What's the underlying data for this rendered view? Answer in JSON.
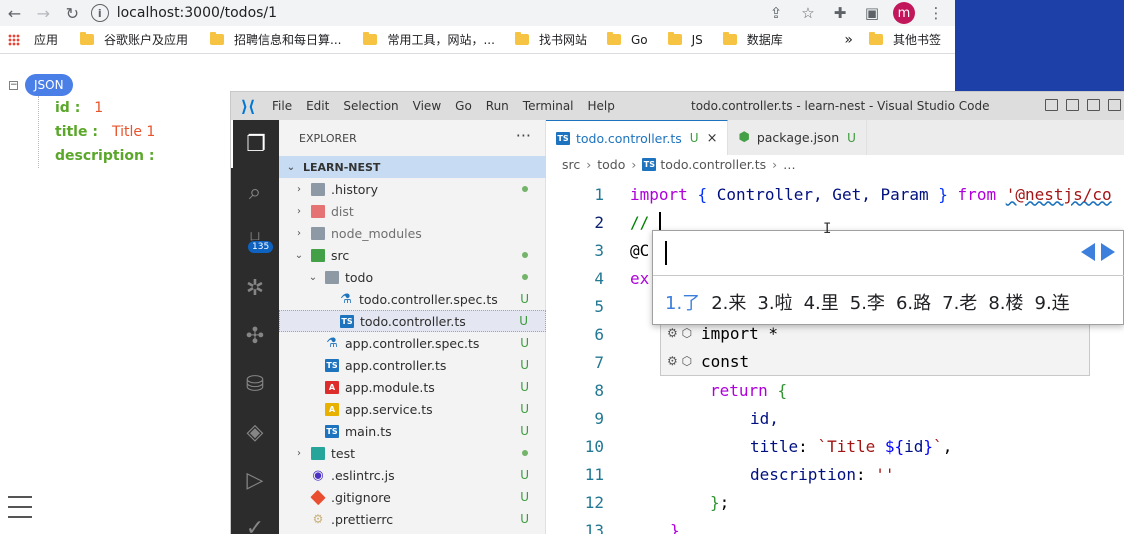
{
  "browser": {
    "url": "localhost:3000/todos/1",
    "bookmarks": [
      {
        "label": "应用",
        "type": "apps"
      },
      {
        "label": "谷歌账户及应用",
        "type": "folder"
      },
      {
        "label": "招聘信息和每日算...",
        "type": "folder"
      },
      {
        "label": "常用工具，网站，...",
        "type": "folder"
      },
      {
        "label": "找书网站",
        "type": "folder"
      },
      {
        "label": "Go",
        "type": "folder"
      },
      {
        "label": "JS",
        "type": "folder"
      },
      {
        "label": "数据库",
        "type": "folder"
      }
    ],
    "bookmarks_overflow": "»",
    "other_bookmarks": "其他书签",
    "avatar_letter": "m"
  },
  "json_viewer": {
    "badge": "JSON",
    "toggle": "−",
    "rows": [
      {
        "key": "id :",
        "value": "1"
      },
      {
        "key": "title :",
        "value": "Title 1"
      },
      {
        "key": "description :",
        "value": ""
      }
    ]
  },
  "vscode": {
    "menu": [
      "File",
      "Edit",
      "Selection",
      "View",
      "Go",
      "Run",
      "Terminal",
      "Help"
    ],
    "window_title": "todo.controller.ts - learn-nest - Visual Studio Code",
    "scm_badge": "135",
    "explorer_title": "EXPLORER",
    "explorer_more": "···",
    "section": "LEARN-NEST",
    "tree": [
      {
        "label": ".history",
        "chev": "›",
        "icon": "folder-g",
        "status": "dot",
        "dim": false
      },
      {
        "label": "dist",
        "chev": "›",
        "icon": "folder-r",
        "status": "",
        "dim": true
      },
      {
        "label": "node_modules",
        "chev": "›",
        "icon": "folder-g",
        "status": "",
        "dim": true
      },
      {
        "label": "src",
        "chev": "⌄",
        "icon": "folder-gr",
        "status": "dot",
        "dim": false
      },
      {
        "label": "todo",
        "chev": "⌄",
        "icon": "folder-g",
        "status": "dot",
        "dim": false
      },
      {
        "label": "todo.controller.spec.ts",
        "chev": "",
        "icon": "spec",
        "status": "U",
        "dim": false
      },
      {
        "label": "todo.controller.ts",
        "chev": "",
        "icon": "ts",
        "status": "U",
        "dim": false,
        "selected": true
      },
      {
        "label": "app.controller.spec.ts",
        "chev": "",
        "icon": "spec",
        "status": "U",
        "dim": false
      },
      {
        "label": "app.controller.ts",
        "chev": "",
        "icon": "ts",
        "status": "U",
        "dim": false
      },
      {
        "label": "app.module.ts",
        "chev": "",
        "icon": "ng",
        "status": "U",
        "dim": false
      },
      {
        "label": "app.service.ts",
        "chev": "",
        "icon": "svc",
        "status": "U",
        "dim": false
      },
      {
        "label": "main.ts",
        "chev": "",
        "icon": "ts",
        "status": "U",
        "dim": false
      },
      {
        "label": "test",
        "chev": "›",
        "icon": "folder-t",
        "status": "dot",
        "dim": false
      },
      {
        "label": ".eslintrc.js",
        "chev": "",
        "icon": "es",
        "status": "U",
        "dim": false
      },
      {
        "label": ".gitignore",
        "chev": "",
        "icon": "git",
        "status": "U",
        "dim": false
      },
      {
        "label": ".prettierrc",
        "chev": "",
        "icon": "pr",
        "status": "U",
        "dim": false
      }
    ],
    "tabs": [
      {
        "label": "todo.controller.ts",
        "status": "U",
        "close": "×",
        "active": true
      },
      {
        "label": "package.json",
        "status": "U",
        "close": "",
        "active": false
      }
    ],
    "breadcrumb": [
      "src",
      "todo",
      "todo.controller.ts",
      "…"
    ],
    "line_numbers": [
      "1",
      "2",
      "3",
      "4",
      "5",
      "6",
      "7",
      "8",
      "9",
      "10",
      "11",
      "12",
      "13"
    ],
    "code_line_1": {
      "import": "import",
      "lb": "{",
      "ids": " Controller, Get, Param ",
      "rb": "}",
      "from": "from",
      "str": "'@nestjs/co"
    },
    "code_line_2": "// ",
    "code_line_3": "@C",
    "code_line_4": "ex",
    "code_line_8": {
      "kw": "return",
      "br": "{"
    },
    "code_line_9": "id,",
    "code_line_10": {
      "key": "title",
      "colon": ": ",
      "str1": "`Title ",
      "tpl_open": "${",
      "tpl_id": "id",
      "tpl_close": "}",
      "str2": "`",
      "comma": ","
    },
    "code_line_11": {
      "key": "description",
      "colon": ": ",
      "str": "''"
    },
    "code_line_12": {
      "br": "}",
      "semi": ";"
    },
    "code_line_13": "}",
    "suggestions": [
      "import *",
      "const"
    ],
    "suggest_icon": "⚙ ⬡"
  },
  "ime": {
    "candidates": [
      "1.了",
      "2.来",
      "3.啦",
      "4.里",
      "5.李",
      "6.路",
      "7.老",
      "8.楼",
      "9.连"
    ]
  }
}
